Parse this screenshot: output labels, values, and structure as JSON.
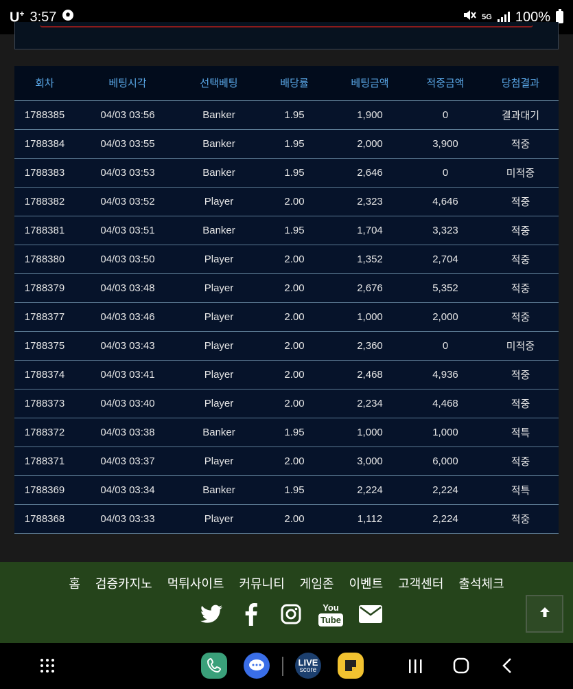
{
  "status_bar": {
    "carrier": "U",
    "carrier_suffix": "+",
    "time": "3:57",
    "battery": "100%",
    "network": "5G"
  },
  "table": {
    "headers": [
      "회차",
      "베팅시각",
      "선택베팅",
      "배당률",
      "베팅금액",
      "적중금액",
      "당첨결과"
    ],
    "rows": [
      {
        "round": "1788385",
        "time": "04/03 03:56",
        "pick": "Banker",
        "odds": "1.95",
        "bet": "1,900",
        "win": "0",
        "result": "결과대기",
        "status": "wait"
      },
      {
        "round": "1788384",
        "time": "04/03 03:55",
        "pick": "Banker",
        "odds": "1.95",
        "bet": "2,000",
        "win": "3,900",
        "result": "적중",
        "status": "win"
      },
      {
        "round": "1788383",
        "time": "04/03 03:53",
        "pick": "Banker",
        "odds": "1.95",
        "bet": "2,646",
        "win": "0",
        "result": "미적중",
        "status": "lose"
      },
      {
        "round": "1788382",
        "time": "04/03 03:52",
        "pick": "Player",
        "odds": "2.00",
        "bet": "2,323",
        "win": "4,646",
        "result": "적중",
        "status": "win"
      },
      {
        "round": "1788381",
        "time": "04/03 03:51",
        "pick": "Banker",
        "odds": "1.95",
        "bet": "1,704",
        "win": "3,323",
        "result": "적중",
        "status": "win"
      },
      {
        "round": "1788380",
        "time": "04/03 03:50",
        "pick": "Player",
        "odds": "2.00",
        "bet": "1,352",
        "win": "2,704",
        "result": "적중",
        "status": "win"
      },
      {
        "round": "1788379",
        "time": "04/03 03:48",
        "pick": "Player",
        "odds": "2.00",
        "bet": "2,676",
        "win": "5,352",
        "result": "적중",
        "status": "win"
      },
      {
        "round": "1788377",
        "time": "04/03 03:46",
        "pick": "Player",
        "odds": "2.00",
        "bet": "1,000",
        "win": "2,000",
        "result": "적중",
        "status": "win"
      },
      {
        "round": "1788375",
        "time": "04/03 03:43",
        "pick": "Player",
        "odds": "2.00",
        "bet": "2,360",
        "win": "0",
        "result": "미적중",
        "status": "lose"
      },
      {
        "round": "1788374",
        "time": "04/03 03:41",
        "pick": "Player",
        "odds": "2.00",
        "bet": "2,468",
        "win": "4,936",
        "result": "적중",
        "status": "win"
      },
      {
        "round": "1788373",
        "time": "04/03 03:40",
        "pick": "Player",
        "odds": "2.00",
        "bet": "2,234",
        "win": "4,468",
        "result": "적중",
        "status": "win"
      },
      {
        "round": "1788372",
        "time": "04/03 03:38",
        "pick": "Banker",
        "odds": "1.95",
        "bet": "1,000",
        "win": "1,000",
        "result": "적특",
        "status": "win"
      },
      {
        "round": "1788371",
        "time": "04/03 03:37",
        "pick": "Player",
        "odds": "2.00",
        "bet": "3,000",
        "win": "6,000",
        "result": "적중",
        "status": "win"
      },
      {
        "round": "1788369",
        "time": "04/03 03:34",
        "pick": "Banker",
        "odds": "1.95",
        "bet": "2,224",
        "win": "2,224",
        "result": "적특",
        "status": "win"
      },
      {
        "round": "1788368",
        "time": "04/03 03:33",
        "pick": "Player",
        "odds": "2.00",
        "bet": "1,112",
        "win": "2,224",
        "result": "적중",
        "status": "win"
      }
    ]
  },
  "footer": {
    "nav": [
      "홈",
      "검증카지노",
      "먹튀사이트",
      "커뮤니티",
      "게임존",
      "이벤트",
      "고객센터",
      "출석체크"
    ],
    "social_icons": [
      "twitter-icon",
      "facebook-icon",
      "instagram-icon",
      "youtube-icon",
      "mail-icon"
    ],
    "youtube_label_top": "You",
    "youtube_label_bottom": "Tube"
  },
  "nav_bar": {
    "apps": [
      "phone-icon",
      "messages-icon",
      "livescore-icon",
      "notes-icon"
    ],
    "livescore_top": "LIVE",
    "livescore_bottom": "score"
  },
  "colors": {
    "header_text": "#5aa8e8",
    "win": "#e9893a",
    "lose": "#ff7a85",
    "footer_bg": "#25441b"
  }
}
